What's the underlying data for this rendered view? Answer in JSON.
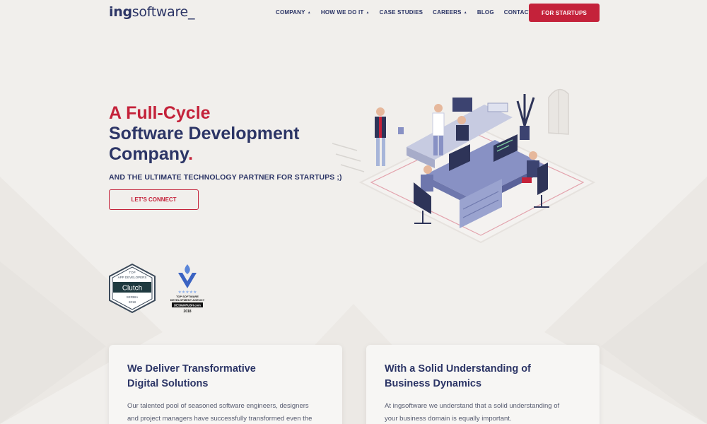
{
  "nav": {
    "logo_bold": "ing",
    "logo_rest": "software_",
    "items": [
      {
        "label": "COMPANY",
        "caret": "▲"
      },
      {
        "label": "HOW WE DO IT",
        "caret": "▲"
      },
      {
        "label": "CASE STUDIES",
        "caret": ""
      },
      {
        "label": "CAREERS",
        "caret": "▲"
      },
      {
        "label": "BLOG",
        "caret": ""
      },
      {
        "label": "CONTACT",
        "caret": ""
      }
    ],
    "cta_label": "FOR STARTUPS"
  },
  "hero": {
    "line1": "A Full-Cycle",
    "line2": "Software Development",
    "line3": "Company",
    "line3_dot": ".",
    "subtitle": "AND THE ULTIMATE TECHNOLOGY PARTNER FOR STARTUPS ;)",
    "cta_label": "LET'S CONNECT"
  },
  "badges": {
    "clutch": {
      "top": "TOP",
      "line": "APP DEVELOPERS",
      "name": "Clutch",
      "country": "SERBIA",
      "year": "2018"
    },
    "designrush": {
      "line1": "TOP SOFTWARE",
      "line2": "DEVELOPMENT AGENCY",
      "name": "DESIGNRUSH.com",
      "year": "2018",
      "stars": "★★★★★"
    }
  },
  "cards": [
    {
      "title_1": "We Deliver Transformative",
      "title_2": "Digital Solutions",
      "text_1": "Our talented pool of seasoned software engineers, designers",
      "text_2": "and project managers have successfully transformed even the"
    },
    {
      "title_1": "With a Solid Understanding of",
      "title_2": "Business Dynamics",
      "text_1": "At ingsoftware we understand that a solid understanding of",
      "text_2": "your business domain is equally important."
    }
  ],
  "colors": {
    "brand_red": "#c4223a",
    "navy": "#2c3566",
    "background": "#f1efec"
  }
}
